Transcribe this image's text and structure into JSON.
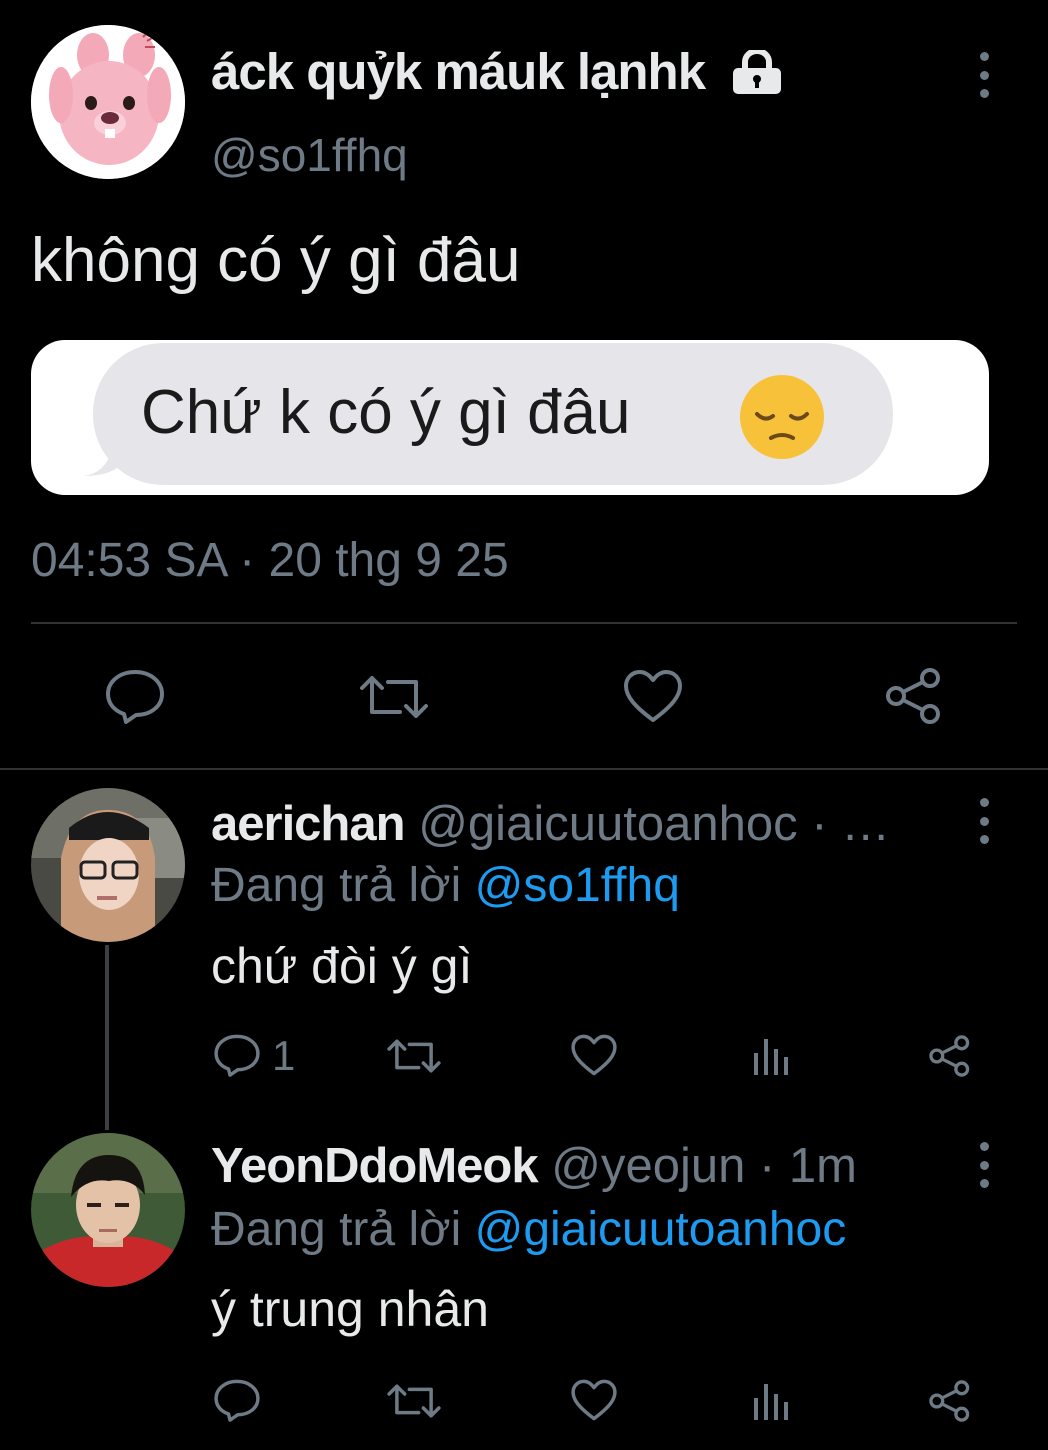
{
  "tweet": {
    "display_name": "áck quỷk máuk lạnhk",
    "handle": "@so1ffhq",
    "text": "không có ý gì đâu",
    "image_text": "Chứ k có ý gì đâu",
    "image_emoji": "pensive-face-emoji",
    "timestamp": "04:53 SA · 20 thg 9 25",
    "icons": [
      "lock-icon",
      "more-vertical-icon",
      "reply-icon",
      "retweet-icon",
      "like-icon",
      "share-icon"
    ]
  },
  "replies": [
    {
      "display_name": "aerichan",
      "handle_time": "@giaicuutoanhoc · …",
      "replying_label": "Đang trả lời",
      "replying_to": "@so1ffhq",
      "text": "chứ đòi ý gì",
      "reply_count": "1"
    },
    {
      "display_name": "YeonDdoMeok",
      "handle_time": "@yeojun · 1m",
      "replying_label": "Đang trả lời",
      "replying_to": "@giaicuutoanhoc",
      "text": "ý trung nhân",
      "reply_count": ""
    }
  ],
  "colors": {
    "background": "#000000",
    "text": "#e7e9ea",
    "muted": "#6e7a85",
    "link": "#1d9bf0",
    "divider": "#2f3336"
  }
}
